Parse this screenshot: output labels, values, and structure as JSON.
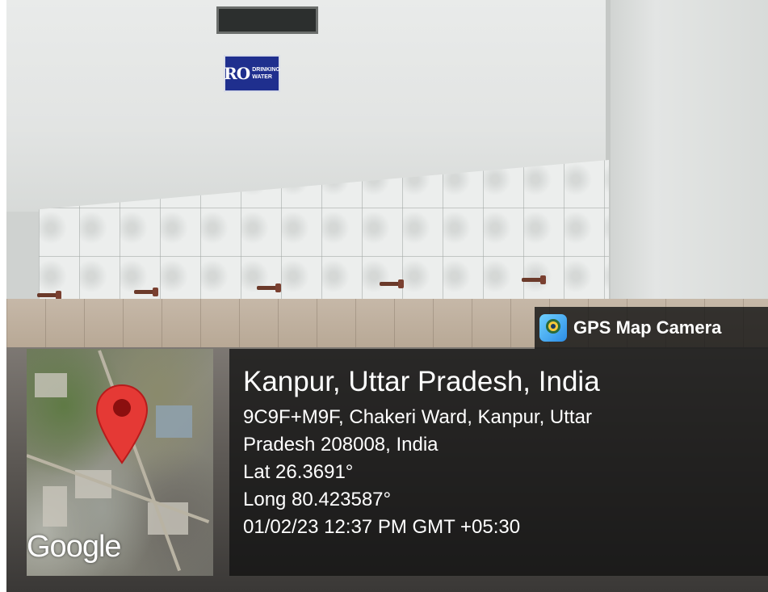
{
  "sign": {
    "main": "RO",
    "sub_line1": "DRINKING",
    "sub_line2": "WATER"
  },
  "overlay": {
    "brand": {
      "label": "GPS Map Camera",
      "icon": "gps-map-camera-app-icon"
    },
    "map": {
      "watermark": "Google",
      "pin_icon": "location-pin-icon",
      "pin_color": "#e53935"
    },
    "location_title": "Kanpur, Uttar Pradesh, India",
    "address_line1": "9C9F+M9F, Chakeri Ward, Kanpur, Uttar",
    "address_line2": "Pradesh 208008, India",
    "latitude": "Lat 26.3691°",
    "longitude": "Long 80.423587°",
    "timestamp": "01/02/23 12:37 PM GMT +05:30"
  }
}
